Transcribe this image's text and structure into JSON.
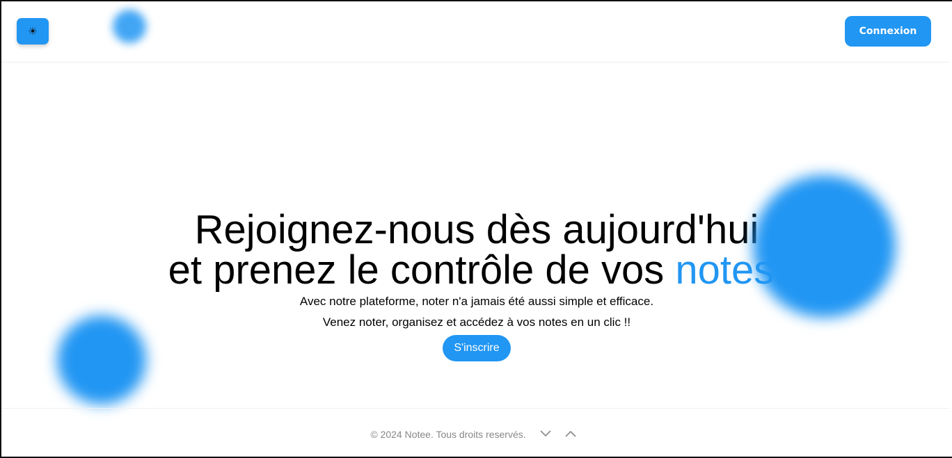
{
  "header": {
    "theme_icon": "☀",
    "login_label": "Connexion"
  },
  "hero": {
    "title_line1": "Rejoignez-nous dès aujourd'hui",
    "title_line2_prefix": "et prenez le contrôle de vos ",
    "title_line2_accent": "notes.",
    "subtitle_line1": "Avec notre plateforme, noter n'a jamais été aussi simple et efficace.",
    "subtitle_line2": "Venez noter, organisez et accédez à vos notes en un clic !!",
    "signup_label": "S'inscrire"
  },
  "footer": {
    "copyright": "© 2024 Notee. Tous droits reservés.",
    "icons": [
      "chevron-down-icon",
      "chevron-up-icon"
    ]
  },
  "colors": {
    "accent": "#2196f3",
    "text": "#000000",
    "muted": "#888888"
  }
}
